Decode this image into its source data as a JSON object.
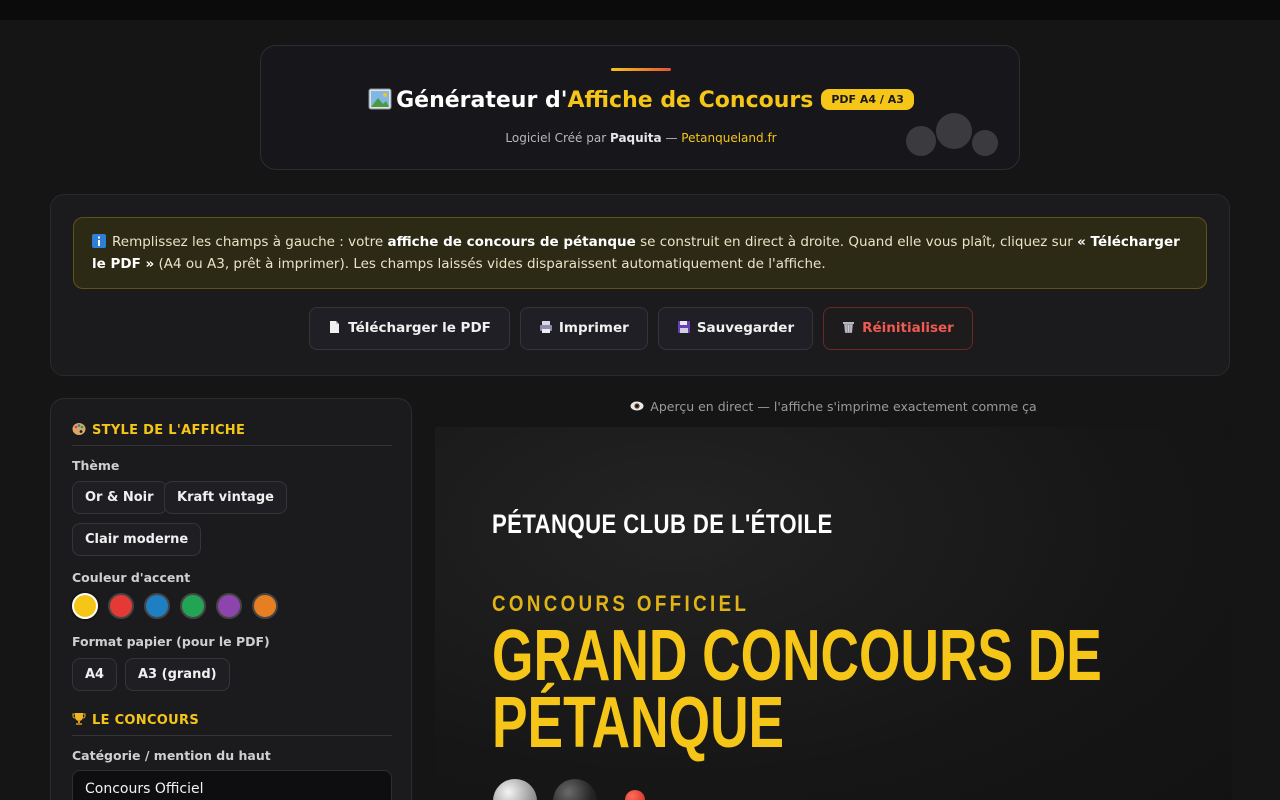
{
  "header": {
    "title_prefix": "Générateur d'",
    "title_accent": "Affiche de Concours",
    "badge": "PDF A4 / A3",
    "subtitle_prefix": "Logiciel Créé par ",
    "author": "Paquita",
    "separator": " — ",
    "site": "Petanqueland.fr"
  },
  "notice": {
    "part1": "Remplissez les champs à gauche : votre ",
    "bold1": "affiche de concours de pétanque",
    "part2": " se construit en direct à droite. Quand elle vous plaît, cliquez sur ",
    "bold2": "« Télécharger le PDF »",
    "part3": " (A4 ou A3, prêt à imprimer). Les champs laissés vides disparaissent automatiquement de l'affiche."
  },
  "actions": {
    "download": "Télécharger le PDF",
    "print": "Imprimer",
    "save": "Sauvegarder",
    "reset": "Réinitialiser"
  },
  "sidebar": {
    "style_section": "STYLE DE L'AFFICHE",
    "theme_label": "Thème",
    "themes": [
      "Or & Noir",
      "Kraft vintage",
      "Clair moderne"
    ],
    "accent_label": "Couleur d'accent",
    "accent_colors": [
      "#f5c518",
      "#e53935",
      "#1e7fc2",
      "#23a455",
      "#8e44ad",
      "#e67e22"
    ],
    "format_label": "Format papier (pour le PDF)",
    "formats": [
      "A4",
      "A3 (grand)"
    ],
    "contest_section": "LE CONCOURS",
    "category_label": "Catégorie / mention du haut",
    "category_value": "Concours Officiel"
  },
  "preview": {
    "caption": "Aperçu en direct — l'affiche s'imprime exactement comme ça",
    "club": "PÉTANQUE CLUB DE L'ÉTOILE",
    "category": "CONCOURS OFFICIEL",
    "title_line1": "GRAND CONCOURS DE",
    "title_line2": "PÉTANQUE"
  }
}
